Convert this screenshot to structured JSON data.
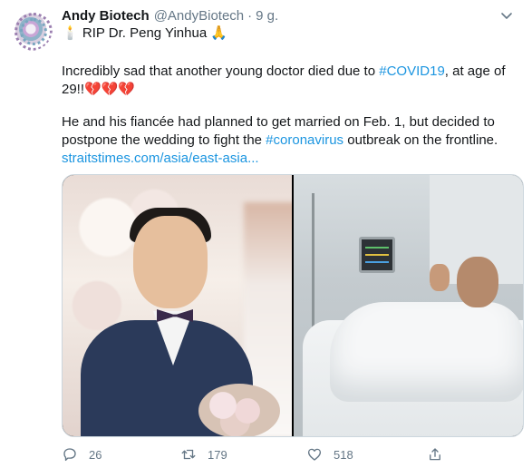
{
  "tweet": {
    "author_name": "Andy Biotech",
    "handle": "@AndyBiotech",
    "separator": "·",
    "time": "9 g.",
    "line1_emoji_start": "🕯️",
    "line1_text": " RIP Dr. Peng Yinhua ",
    "line1_emoji_end": "🙏",
    "para2_text": "Incredibly sad that another young doctor died due to ",
    "para2_hashtag": "#COVID19",
    "para2_text_end": ", at age of 29!!",
    "para2_emoji": "💔💔💔",
    "para3_text": "He and his fiancée had planned to get married on Feb. 1, but decided to postpone the wedding to fight the ",
    "para3_hashtag": "#coronavirus",
    "para3_text_end": " outbreak on the frontline.",
    "link_text": "straitstimes.com/asia/east-asia..."
  },
  "actions": {
    "reply_count": "26",
    "retweet_count": "179",
    "like_count": "518"
  },
  "icons": {
    "caret": "chevron-down-icon",
    "reply": "reply-icon",
    "retweet": "retweet-icon",
    "like": "heart-icon",
    "share": "share-icon"
  },
  "colors": {
    "link": "#1b95e0",
    "secondary_text": "#657786",
    "primary_text": "#14171a"
  }
}
